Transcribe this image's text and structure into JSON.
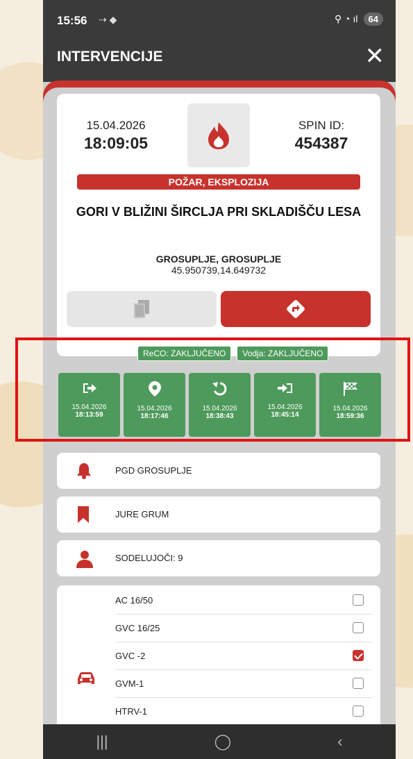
{
  "status_bar": {
    "time": "15:56",
    "signals": "⇢ ◆",
    "right_icons": "⚲ ◔ ıl",
    "battery": "64"
  },
  "header": {
    "title": "INTERVENCIJE",
    "close": "✕"
  },
  "event": {
    "date": "15.04.2026",
    "time": "18:09:05",
    "spin_label": "SPIN ID:",
    "spin_id": "454387",
    "type": "POŽAR, EKSPLOZIJA",
    "title": "GORI V BLIŽINI ŠIRCLJA PRI SKLADIŠČU LESA",
    "location": "GROSUPLJE, GROSUPLJE",
    "coordinates": "45.950739,14.649732"
  },
  "badges": {
    "reco": "ReCO: ZAKLJUČENO",
    "vodja": "Vodja: ZAKLJUČENO"
  },
  "status_tiles": [
    {
      "icon": "exit-icon",
      "date": "15.04.2026",
      "time": "18:13:59"
    },
    {
      "icon": "location-pin-icon",
      "date": "15.04.2026",
      "time": "18:17:46"
    },
    {
      "icon": "return-icon",
      "date": "15.04.2026",
      "time": "18:38:43"
    },
    {
      "icon": "enter-icon",
      "date": "15.04.2026",
      "time": "18:45:14"
    },
    {
      "icon": "finish-flag-icon",
      "date": "15.04.2026",
      "time": "18:59:36"
    }
  ],
  "info": {
    "unit": "PGD GROSUPLJE",
    "leader": "JURE GRUM",
    "participants": "SODELUJOČI: 9"
  },
  "vehicles": [
    {
      "name": "AC 16/50",
      "checked": false
    },
    {
      "name": "GVC 16/25",
      "checked": false
    },
    {
      "name": "GVC -2",
      "checked": true
    },
    {
      "name": "GVM-1",
      "checked": false
    },
    {
      "name": "HTRV-1",
      "checked": false
    }
  ],
  "navbar": {
    "recent": "|||",
    "home": "◯",
    "back": "‹"
  },
  "colors": {
    "red": "#c8322d",
    "green": "#4e9a5c",
    "header": "#3a3a3a"
  }
}
